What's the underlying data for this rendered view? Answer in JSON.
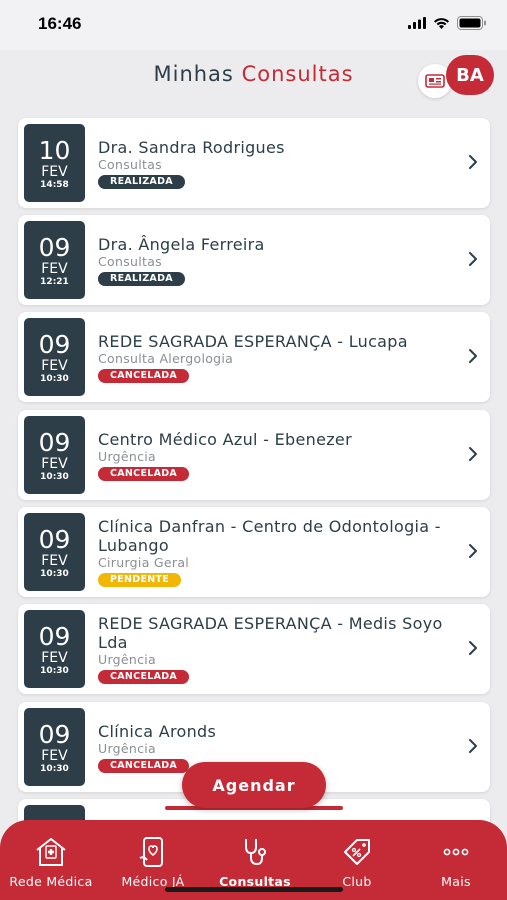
{
  "status_bar": {
    "time": "16:46"
  },
  "header": {
    "title_part1": "Minhas",
    "title_part2": "Consultas",
    "avatar_initials": "BA"
  },
  "colors": {
    "brand_red": "#c52a37",
    "dark": "#2d3e48",
    "pending_yellow": "#f2b705"
  },
  "appointments": [
    {
      "day": "10",
      "month": "FEV",
      "time": "14:58",
      "title": "Dra. Sandra Rodrigues",
      "subtitle": "Consultas",
      "status": "REALIZADA"
    },
    {
      "day": "09",
      "month": "FEV",
      "time": "12:21",
      "title": "Dra. Ângela Ferreira",
      "subtitle": "Consultas",
      "status": "REALIZADA"
    },
    {
      "day": "09",
      "month": "FEV",
      "time": "10:30",
      "title": "REDE SAGRADA ESPERANÇA - Lucapa",
      "subtitle": "Consulta Alergologia",
      "status": "CANCELADA"
    },
    {
      "day": "09",
      "month": "FEV",
      "time": "10:30",
      "title": "Centro Médico Azul - Ebenezer",
      "subtitle": "Urgência",
      "status": "CANCELADA"
    },
    {
      "day": "09",
      "month": "FEV",
      "time": "10:30",
      "title": "Clínica Danfran - Centro de Odontologia - Lubango",
      "subtitle": "Cirurgia Geral",
      "status": "PENDENTE"
    },
    {
      "day": "09",
      "month": "FEV",
      "time": "10:30",
      "title": "REDE SAGRADA ESPERANÇA - Medis Soyo Lda",
      "subtitle": "Urgência",
      "status": "CANCELADA"
    },
    {
      "day": "09",
      "month": "FEV",
      "time": "10:30",
      "title": "Clínica Aronds",
      "subtitle": "Urgência",
      "status": "CANCELADA"
    }
  ],
  "fab": {
    "label": "Agendar"
  },
  "bottom_nav": [
    {
      "label": "Rede Médica",
      "icon": "hospital-icon"
    },
    {
      "label": "Médico JÁ",
      "icon": "phone-health-icon"
    },
    {
      "label": "Consultas",
      "icon": "stethoscope-icon",
      "active": true
    },
    {
      "label": "Club",
      "icon": "discount-tag-icon"
    },
    {
      "label": "Mais",
      "icon": "more-dots-icon"
    }
  ]
}
